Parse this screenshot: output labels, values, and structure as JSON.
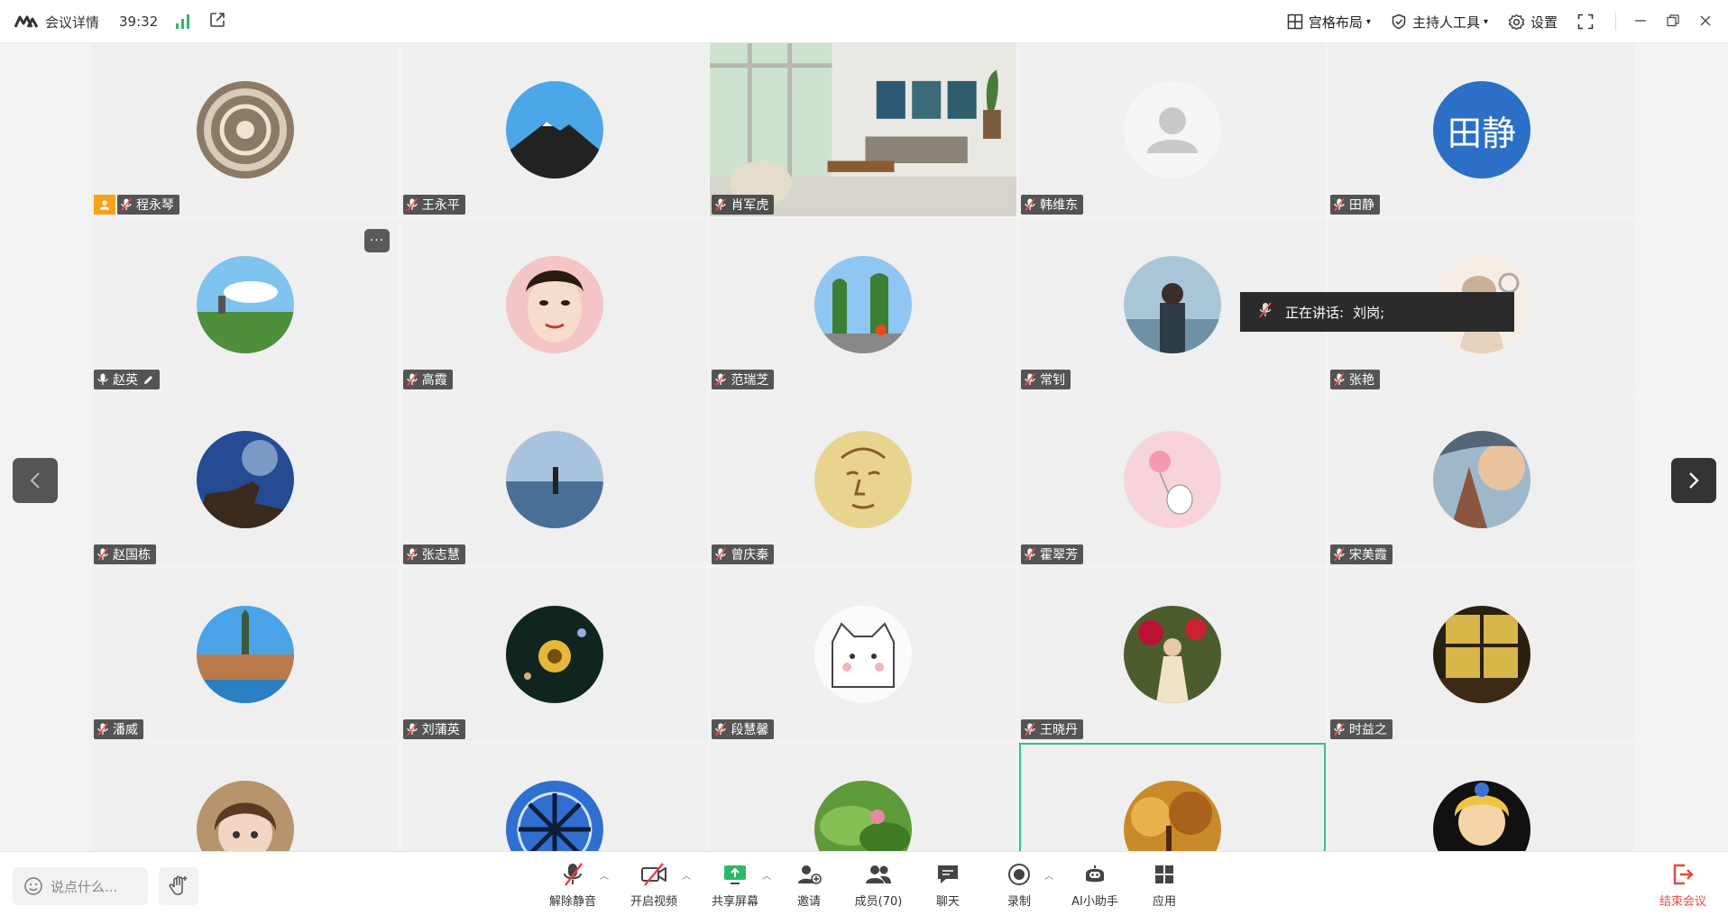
{
  "topbar": {
    "meeting_info": "会议详情",
    "duration": "39:32",
    "layout_label": "宫格布局",
    "host_tools_label": "主持人工具",
    "settings_label": "设置"
  },
  "colors": {
    "accent_green": "#2fc18c",
    "host_badge": "#f7a21b",
    "end_red": "#e54b3c",
    "av_blue": "#2c6fc7"
  },
  "speaking_toast": {
    "label": "正在讲话:",
    "name": "刘岗;"
  },
  "participants": [
    {
      "name": "程永琴",
      "host": true
    },
    {
      "name": "王永平"
    },
    {
      "name": "肖军虎"
    },
    {
      "name": "韩维东"
    },
    {
      "name": "田静",
      "initials": "田静"
    },
    {
      "name": "赵英",
      "mic_on": true,
      "editing": true
    },
    {
      "name": "高霞"
    },
    {
      "name": "范瑞芝"
    },
    {
      "name": "常钊"
    },
    {
      "name": "张艳"
    },
    {
      "name": "赵国栋"
    },
    {
      "name": "张志慧"
    },
    {
      "name": "曾庆秦"
    },
    {
      "name": "霍翠芳"
    },
    {
      "name": "宋美霞"
    },
    {
      "name": "潘威"
    },
    {
      "name": "刘蒲英"
    },
    {
      "name": "段慧馨"
    },
    {
      "name": "王晓丹"
    },
    {
      "name": "时益之"
    },
    {
      "name": ""
    },
    {
      "name": ""
    },
    {
      "name": ""
    },
    {
      "name": ""
    },
    {
      "name": ""
    }
  ],
  "bottombar": {
    "chat_placeholder": "说点什么...",
    "unmute": "解除静音",
    "video": "开启视频",
    "share": "共享屏幕",
    "invite": "邀请",
    "members": "成员(70)",
    "chat": "聊天",
    "record": "录制",
    "ai": "AI小助手",
    "apps": "应用",
    "end": "结束会议"
  }
}
